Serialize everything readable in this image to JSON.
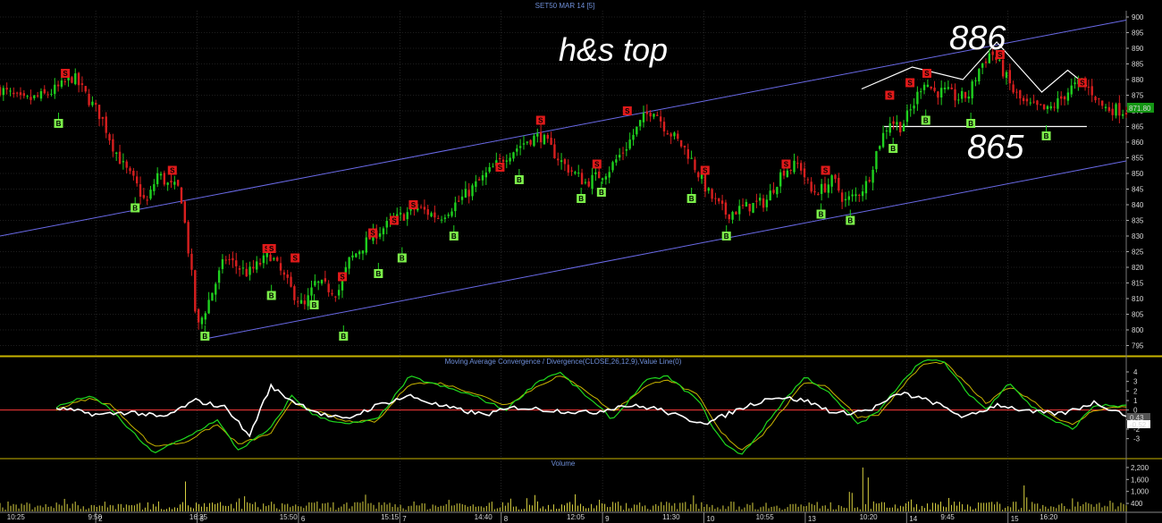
{
  "header": {
    "title": "SET50 MAR 14  [5]"
  },
  "colors": {
    "background": "#000000",
    "grid": "#3c3c3c",
    "panel_border": "#c8b400",
    "up_candle": "#1fd01f",
    "down_candle": "#d81f1f",
    "channel": "#6a6ae8",
    "sell_box": "#e01a1a",
    "buy_box": "#7cf04a",
    "macd": "#1ed81e",
    "signal": "#c8b400",
    "value_line": "#ff3a3a",
    "histogram": "#ffffff",
    "volume": "#d8d040",
    "last_price_box": "#149614"
  },
  "chart_data": [
    {
      "type": "candlestick",
      "panel": "price",
      "title": "SET50 MAR 14  [5]",
      "ylim": [
        792,
        902
      ],
      "y_ticks": [
        795,
        800,
        805,
        810,
        815,
        820,
        825,
        830,
        835,
        840,
        845,
        850,
        855,
        860,
        865,
        870,
        875,
        880,
        885,
        890,
        895,
        900
      ],
      "last_price": "871.80",
      "annotations": {
        "pattern": "h&s top",
        "high_label": "886",
        "neckline_label": "865",
        "neckline_level": 865
      },
      "channel": {
        "upper": [
          {
            "x": 0,
            "y": 830
          },
          {
            "x": 1,
            "y": 899
          }
        ],
        "lower": [
          {
            "x": 0.18,
            "y": 797
          },
          {
            "x": 1,
            "y": 854
          }
        ]
      },
      "path_anchors": [
        [
          0,
          877
        ],
        [
          0.02,
          873
        ],
        [
          0.04,
          875
        ],
        [
          0.055,
          878
        ],
        [
          0.065,
          881
        ],
        [
          0.08,
          873
        ],
        [
          0.09,
          868
        ],
        [
          0.1,
          859
        ],
        [
          0.11,
          852
        ],
        [
          0.12,
          847
        ],
        [
          0.13,
          840
        ],
        [
          0.14,
          850
        ],
        [
          0.15,
          846
        ],
        [
          0.16,
          845
        ],
        [
          0.17,
          818
        ],
        [
          0.175,
          800
        ],
        [
          0.185,
          809
        ],
        [
          0.2,
          823
        ],
        [
          0.22,
          818
        ],
        [
          0.24,
          824
        ],
        [
          0.25,
          818
        ],
        [
          0.26,
          812
        ],
        [
          0.27,
          807
        ],
        [
          0.28,
          815
        ],
        [
          0.3,
          812
        ],
        [
          0.31,
          822
        ],
        [
          0.33,
          830
        ],
        [
          0.35,
          835
        ],
        [
          0.37,
          839
        ],
        [
          0.39,
          836
        ],
        [
          0.41,
          842
        ],
        [
          0.43,
          849
        ],
        [
          0.45,
          856
        ],
        [
          0.47,
          861
        ],
        [
          0.48,
          862
        ],
        [
          0.5,
          853
        ],
        [
          0.52,
          847
        ],
        [
          0.54,
          851
        ],
        [
          0.555,
          858
        ],
        [
          0.57,
          867
        ],
        [
          0.58,
          871
        ],
        [
          0.59,
          865
        ],
        [
          0.61,
          857
        ],
        [
          0.62,
          850
        ],
        [
          0.63,
          843
        ],
        [
          0.645,
          837
        ],
        [
          0.66,
          839
        ],
        [
          0.68,
          841
        ],
        [
          0.695,
          851
        ],
        [
          0.71,
          853
        ],
        [
          0.72,
          844
        ],
        [
          0.73,
          845
        ],
        [
          0.74,
          848
        ],
        [
          0.75,
          841
        ],
        [
          0.76,
          843
        ],
        [
          0.77,
          847
        ],
        [
          0.78,
          859
        ],
        [
          0.79,
          867
        ],
        [
          0.8,
          865
        ],
        [
          0.81,
          871
        ],
        [
          0.82,
          880
        ],
        [
          0.83,
          876
        ],
        [
          0.84,
          876
        ],
        [
          0.85,
          874
        ],
        [
          0.86,
          875
        ],
        [
          0.87,
          884
        ],
        [
          0.88,
          889
        ],
        [
          0.89,
          883
        ],
        [
          0.9,
          876
        ],
        [
          0.91,
          872
        ],
        [
          0.93,
          870
        ],
        [
          0.94,
          873
        ],
        [
          0.95,
          877
        ],
        [
          0.96,
          879
        ],
        [
          0.97,
          876
        ],
        [
          0.98,
          871
        ],
        [
          1,
          870
        ]
      ],
      "signals": [
        {
          "side": "S",
          "x": 0.058,
          "y": 882
        },
        {
          "side": "B",
          "x": 0.052,
          "y": 866
        },
        {
          "side": "B",
          "x": 0.12,
          "y": 839
        },
        {
          "side": "S",
          "x": 0.153,
          "y": 851
        },
        {
          "side": "B",
          "x": 0.182,
          "y": 798
        },
        {
          "side": "S",
          "x": 0.237,
          "y": 826
        },
        {
          "side": "S",
          "x": 0.241,
          "y": 826
        },
        {
          "side": "B",
          "x": 0.241,
          "y": 811
        },
        {
          "side": "S",
          "x": 0.262,
          "y": 823
        },
        {
          "side": "B",
          "x": 0.279,
          "y": 808
        },
        {
          "side": "S",
          "x": 0.304,
          "y": 817
        },
        {
          "side": "B",
          "x": 0.305,
          "y": 798
        },
        {
          "side": "S",
          "x": 0.331,
          "y": 831
        },
        {
          "side": "B",
          "x": 0.336,
          "y": 818
        },
        {
          "side": "S",
          "x": 0.35,
          "y": 835
        },
        {
          "side": "S",
          "x": 0.367,
          "y": 840
        },
        {
          "side": "B",
          "x": 0.357,
          "y": 823
        },
        {
          "side": "B",
          "x": 0.403,
          "y": 830
        },
        {
          "side": "S",
          "x": 0.444,
          "y": 852
        },
        {
          "side": "B",
          "x": 0.461,
          "y": 848
        },
        {
          "side": "S",
          "x": 0.48,
          "y": 867
        },
        {
          "side": "B",
          "x": 0.516,
          "y": 842
        },
        {
          "side": "B",
          "x": 0.534,
          "y": 844
        },
        {
          "side": "S",
          "x": 0.53,
          "y": 853
        },
        {
          "side": "S",
          "x": 0.557,
          "y": 870
        },
        {
          "side": "B",
          "x": 0.614,
          "y": 842
        },
        {
          "side": "S",
          "x": 0.626,
          "y": 851
        },
        {
          "side": "B",
          "x": 0.645,
          "y": 830
        },
        {
          "side": "S",
          "x": 0.698,
          "y": 853
        },
        {
          "side": "S",
          "x": 0.733,
          "y": 851
        },
        {
          "side": "B",
          "x": 0.729,
          "y": 837
        },
        {
          "side": "B",
          "x": 0.755,
          "y": 835
        },
        {
          "side": "S",
          "x": 0.79,
          "y": 875
        },
        {
          "side": "B",
          "x": 0.793,
          "y": 858
        },
        {
          "side": "S",
          "x": 0.808,
          "y": 879
        },
        {
          "side": "S",
          "x": 0.823,
          "y": 882
        },
        {
          "side": "B",
          "x": 0.822,
          "y": 867
        },
        {
          "side": "B",
          "x": 0.862,
          "y": 866
        },
        {
          "side": "S",
          "x": 0.888,
          "y": 888
        },
        {
          "side": "B",
          "x": 0.929,
          "y": 862
        },
        {
          "side": "S",
          "x": 0.961,
          "y": 879
        }
      ]
    },
    {
      "type": "line",
      "panel": "indicator",
      "title": "Moving Average Convergence / Divergence(CLOSE,26,12,9),Value Line(0)",
      "ylim": [
        -5,
        5.5
      ],
      "y_ticks": [
        -3,
        -2,
        -1,
        0,
        1,
        2,
        3,
        4
      ],
      "last_values": [
        "0.43",
        "-0.52"
      ],
      "series_anchors": {
        "macd": [
          [
            0,
            0.3
          ],
          [
            0.03,
            1.5
          ],
          [
            0.05,
            0.2
          ],
          [
            0.07,
            -2.2
          ],
          [
            0.09,
            -4.5
          ],
          [
            0.12,
            -3
          ],
          [
            0.15,
            -1
          ],
          [
            0.17,
            -4.2
          ],
          [
            0.2,
            -2
          ],
          [
            0.22,
            1.5
          ],
          [
            0.24,
            -0.5
          ],
          [
            0.27,
            -1.5
          ],
          [
            0.3,
            -1
          ],
          [
            0.33,
            3.5
          ],
          [
            0.36,
            2.5
          ],
          [
            0.39,
            1.5
          ],
          [
            0.42,
            0
          ],
          [
            0.45,
            3
          ],
          [
            0.47,
            4
          ],
          [
            0.49,
            2
          ],
          [
            0.52,
            -1
          ],
          [
            0.55,
            3
          ],
          [
            0.57,
            3.6
          ],
          [
            0.6,
            1
          ],
          [
            0.62,
            -3
          ],
          [
            0.64,
            -4.8
          ],
          [
            0.66,
            -2
          ],
          [
            0.68,
            1
          ],
          [
            0.7,
            3.5
          ],
          [
            0.72,
            2
          ],
          [
            0.75,
            -1.5
          ],
          [
            0.77,
            0
          ],
          [
            0.79,
            3
          ],
          [
            0.81,
            5.3
          ],
          [
            0.83,
            5
          ],
          [
            0.85,
            2
          ],
          [
            0.87,
            0
          ],
          [
            0.89,
            3
          ],
          [
            0.91,
            0.5
          ],
          [
            0.93,
            -1
          ],
          [
            0.95,
            -2
          ],
          [
            0.97,
            0.5
          ],
          [
            1,
            0.4
          ]
        ],
        "signal": [
          [
            0,
            0.1
          ],
          [
            0.03,
            1.2
          ],
          [
            0.05,
            0.6
          ],
          [
            0.07,
            -1.5
          ],
          [
            0.09,
            -3.8
          ],
          [
            0.12,
            -3.4
          ],
          [
            0.15,
            -1.5
          ],
          [
            0.17,
            -3.6
          ],
          [
            0.2,
            -2.5
          ],
          [
            0.22,
            0.8
          ],
          [
            0.24,
            0
          ],
          [
            0.27,
            -1.2
          ],
          [
            0.3,
            -1.2
          ],
          [
            0.33,
            2.8
          ],
          [
            0.36,
            2.8
          ],
          [
            0.39,
            1.8
          ],
          [
            0.42,
            0.5
          ],
          [
            0.45,
            2.5
          ],
          [
            0.47,
            3.6
          ],
          [
            0.49,
            2.5
          ],
          [
            0.52,
            -0.2
          ],
          [
            0.55,
            2.4
          ],
          [
            0.57,
            3.3
          ],
          [
            0.6,
            1.5
          ],
          [
            0.62,
            -2.2
          ],
          [
            0.64,
            -4.2
          ],
          [
            0.66,
            -2.6
          ],
          [
            0.68,
            0.2
          ],
          [
            0.7,
            3
          ],
          [
            0.72,
            2.5
          ],
          [
            0.75,
            -0.8
          ],
          [
            0.77,
            -0.4
          ],
          [
            0.79,
            2.4
          ],
          [
            0.81,
            4.8
          ],
          [
            0.83,
            5
          ],
          [
            0.85,
            2.8
          ],
          [
            0.87,
            0.6
          ],
          [
            0.89,
            2.5
          ],
          [
            0.91,
            1.2
          ],
          [
            0.93,
            -0.5
          ],
          [
            0.95,
            -1.6
          ],
          [
            0.97,
            0
          ],
          [
            1,
            0.4
          ]
        ],
        "histogram": [
          [
            0,
            0.2
          ],
          [
            0.04,
            -0.5
          ],
          [
            0.07,
            -0.2
          ],
          [
            0.1,
            -0.8
          ],
          [
            0.13,
            1
          ],
          [
            0.16,
            0.2
          ],
          [
            0.18,
            -2.8
          ],
          [
            0.2,
            2.5
          ],
          [
            0.22,
            1
          ],
          [
            0.25,
            -0.5
          ],
          [
            0.27,
            -1
          ],
          [
            0.3,
            0.5
          ],
          [
            0.33,
            1.5
          ],
          [
            0.36,
            0.4
          ],
          [
            0.4,
            -0.5
          ],
          [
            0.43,
            0.3
          ],
          [
            0.46,
            0
          ],
          [
            0.5,
            -0.3
          ],
          [
            0.53,
            0.5
          ],
          [
            0.56,
            0.2
          ],
          [
            0.59,
            -1
          ],
          [
            0.61,
            -1.3
          ],
          [
            0.64,
            0.2
          ],
          [
            0.67,
            1.4
          ],
          [
            0.7,
            1
          ],
          [
            0.73,
            -0.4
          ],
          [
            0.76,
            0
          ],
          [
            0.79,
            1.8
          ],
          [
            0.82,
            0.8
          ],
          [
            0.85,
            -0.8
          ],
          [
            0.88,
            0.6
          ],
          [
            0.91,
            -0.2
          ],
          [
            0.94,
            -0.4
          ],
          [
            0.97,
            0.8
          ],
          [
            1,
            -0.5
          ]
        ]
      }
    },
    {
      "type": "bar",
      "panel": "volume",
      "title": "Volume",
      "ylim": [
        0,
        2600
      ],
      "y_ticks": [
        "2,200",
        "1,600",
        "1,000",
        "400"
      ],
      "peaks": [
        {
          "x": 0.765,
          "value": 2200
        },
        {
          "x": 0.77,
          "value": 1700
        },
        {
          "x": 0.165,
          "value": 1500
        },
        {
          "x": 0.91,
          "value": 1300
        }
      ]
    }
  ],
  "x_axis": {
    "time_labels": [
      "10:25",
      "9:50",
      "16:25",
      "15:50",
      "15:15",
      "14:40",
      "12:05",
      "11:30",
      "10:55",
      "10:20",
      "9:45",
      "16:20"
    ],
    "day_labels": [
      "2",
      "3",
      "6",
      "7",
      "8",
      "9",
      "10",
      "13",
      "14",
      "15"
    ]
  }
}
